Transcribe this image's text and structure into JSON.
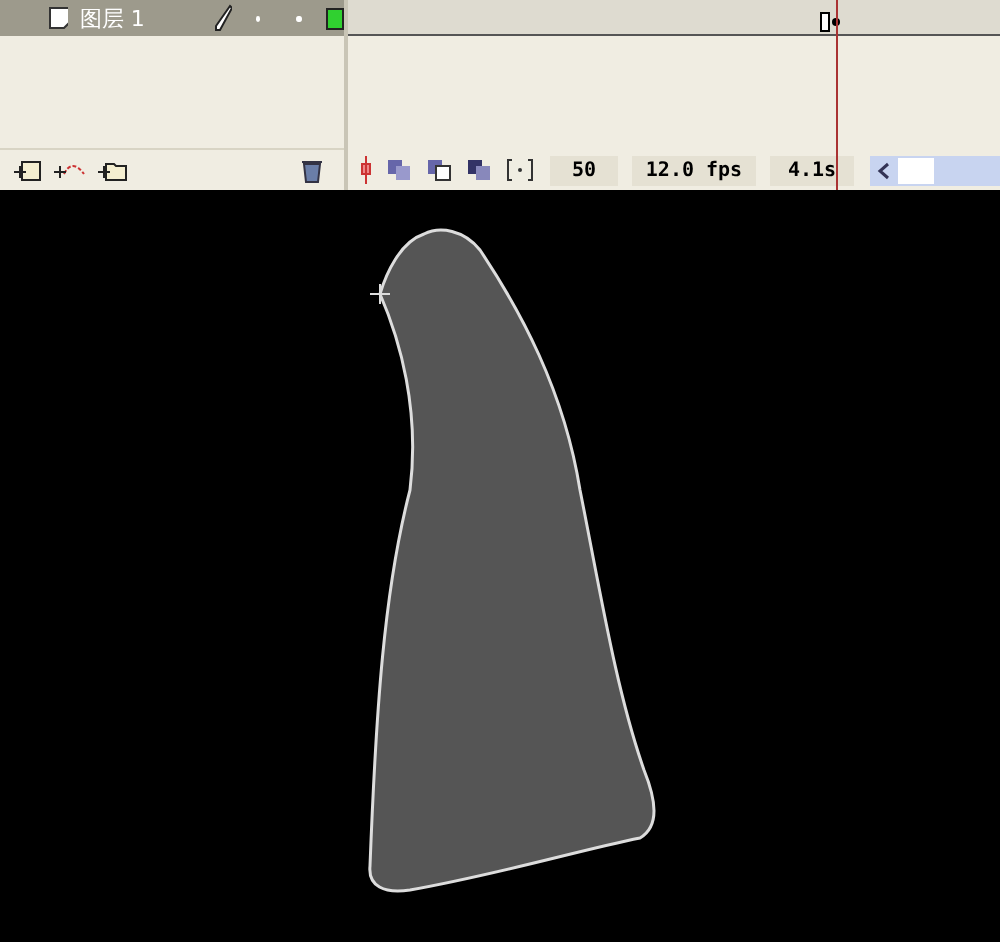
{
  "layers": [
    {
      "name": "图层 1",
      "selected": true
    }
  ],
  "timeline": {
    "current_frame": "50",
    "frame_rate": "12.0 fps",
    "elapsed_time": "4.1s"
  }
}
